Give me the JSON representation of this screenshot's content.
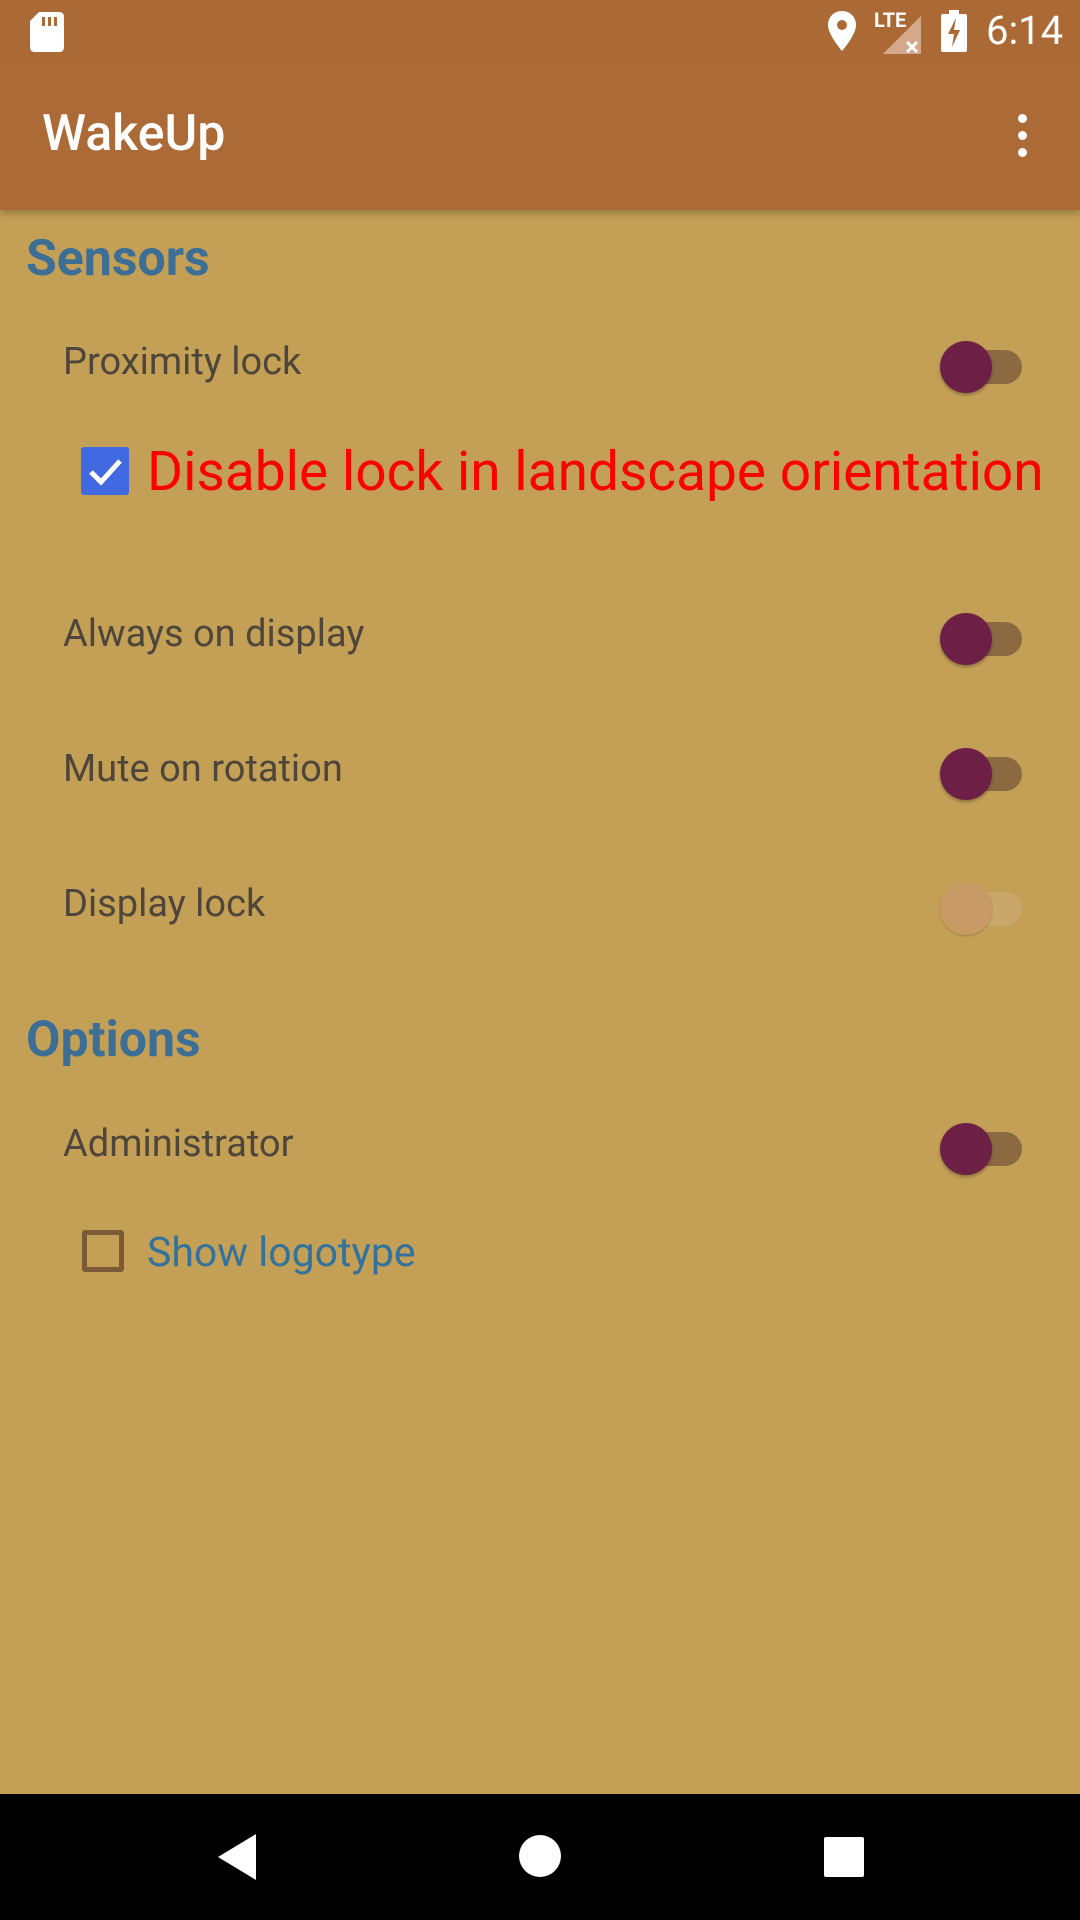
{
  "status_bar": {
    "time": "6:14",
    "network_label": "LTE",
    "icons": [
      "sd-card-icon",
      "location-icon",
      "lte-signal-icon",
      "battery-charging-icon"
    ]
  },
  "app_bar": {
    "title": "WakeUp",
    "overflow_icon": "more-vert-icon"
  },
  "sensors": {
    "header": "Sensors",
    "proximity_lock": {
      "label": "Proximity lock",
      "on": false
    },
    "disable_landscape": {
      "label": "Disable lock in landscape orientation",
      "checked": true
    },
    "always_on_display": {
      "label": "Always on display",
      "on": false
    },
    "mute_on_rotation": {
      "label": "Mute on rotation",
      "on": false
    },
    "display_lock": {
      "label": "Display lock",
      "on": false,
      "enabled": false
    }
  },
  "options": {
    "header": "Options",
    "administrator": {
      "label": "Administrator",
      "on": false
    },
    "show_logotype": {
      "label": "Show logotype",
      "checked": false
    }
  },
  "navigation": [
    "back-icon",
    "home-icon",
    "recents-icon"
  ],
  "colors": {
    "background": "#C4A056",
    "app_bar": "#AC6A37",
    "header_text": "#3C6E96",
    "accent_thumb": "#6E1F46",
    "highlight_text": "#FF0000",
    "checkbox_checked": "#4169E1"
  }
}
